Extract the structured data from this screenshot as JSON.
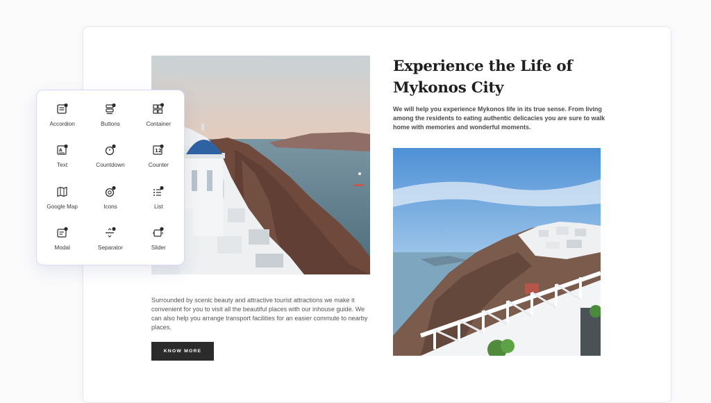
{
  "widgets": [
    {
      "label": "Accordion",
      "icon": "accordion-icon"
    },
    {
      "label": "Buttons",
      "icon": "buttons-icon"
    },
    {
      "label": "Container",
      "icon": "container-icon"
    },
    {
      "label": "Text",
      "icon": "text-icon"
    },
    {
      "label": "Countdown",
      "icon": "countdown-icon"
    },
    {
      "label": "Counter",
      "icon": "counter-icon"
    },
    {
      "label": "Google Map",
      "icon": "map-icon"
    },
    {
      "label": "Icons",
      "icon": "icons-icon"
    },
    {
      "label": "List",
      "icon": "list-icon"
    },
    {
      "label": "Modal",
      "icon": "modal-icon"
    },
    {
      "label": "Separator",
      "icon": "separator-icon"
    },
    {
      "label": "Slider",
      "icon": "slider-icon"
    }
  ],
  "content": {
    "heading": "Experience the Life of Mykonos City",
    "subtext": "We will help you experience Mykonos life in its true sense. From living among the residents to eating authentic delicacies you are sure to walk home with memories and wonderful moments.",
    "body": "Surrounded by scenic beauty and attractive tourist attractions we make it convenient for you to visit all the beautiful places with our inhouse guide. We can also help you arrange transport facilities for an easier commute to nearby places.",
    "button_label": "KNOW MORE"
  },
  "colors": {
    "button_bg": "#2b2b2b",
    "panel_border": "#d6dafc",
    "heading": "#1f1f1f"
  }
}
